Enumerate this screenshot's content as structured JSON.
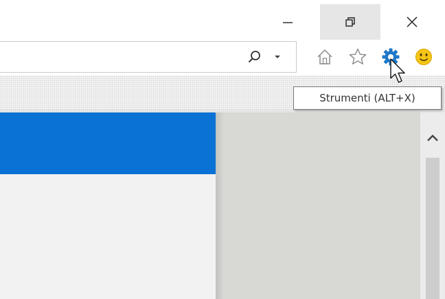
{
  "window_controls": {
    "minimize_icon": "minimize-icon",
    "restore_icon": "restore-icon",
    "close_icon": "close-icon"
  },
  "address_bar": {
    "value": "",
    "search_icon": "search-icon",
    "dropdown_icon": "chevron-down-icon"
  },
  "toolbar": {
    "icons": [
      "home-icon",
      "favorites-star-icon",
      "tools-gear-icon",
      "feedback-smiley-icon"
    ]
  },
  "tooltip": {
    "text": "Strumenti (ALT+X)"
  },
  "colors": {
    "accent_blue": "#0a72d4",
    "gear_blue": "#1f78c8",
    "smiley_yellow": "#f5c518"
  }
}
